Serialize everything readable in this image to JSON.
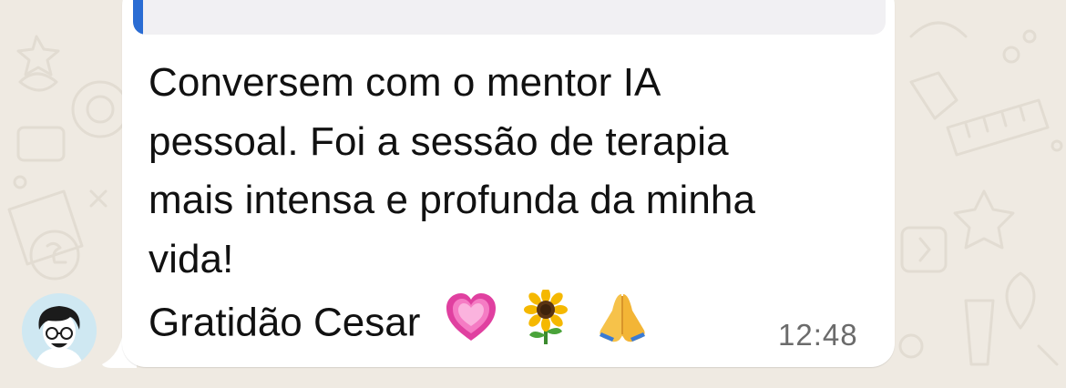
{
  "message": {
    "text": "Conversem com o mentor IA\npessoal. Foi a sessão de terapia\nmais intensa e profunda da minha\nvida!",
    "signoff": "Gratidão Cesar",
    "emojis": [
      "heart-icon",
      "sunflower-icon",
      "folded-hands-icon"
    ],
    "timestamp": "12:48"
  },
  "sender": {
    "avatar": "avatar-icon"
  },
  "colors": {
    "wallpaper": "#efeae2",
    "bubble": "#ffffff",
    "quote_bar": "#2a6cd3",
    "quote_background": "#f1f0f3",
    "timestamp": "#6b6b6b"
  }
}
